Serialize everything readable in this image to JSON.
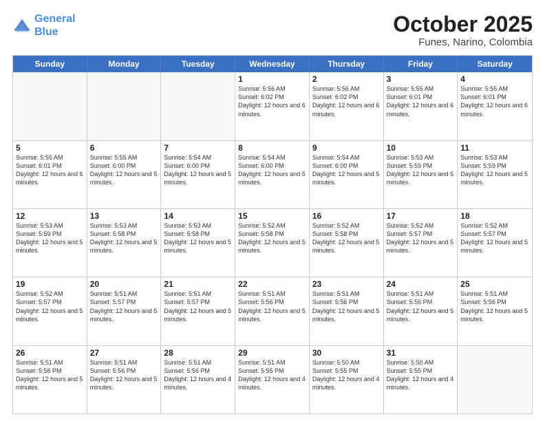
{
  "header": {
    "logo_line1": "General",
    "logo_line2": "Blue",
    "title": "October 2025",
    "subtitle": "Funes, Narino, Colombia"
  },
  "weekdays": [
    "Sunday",
    "Monday",
    "Tuesday",
    "Wednesday",
    "Thursday",
    "Friday",
    "Saturday"
  ],
  "rows": [
    [
      {
        "day": "",
        "info": "",
        "empty": true
      },
      {
        "day": "",
        "info": "",
        "empty": true
      },
      {
        "day": "",
        "info": "",
        "empty": true
      },
      {
        "day": "1",
        "info": "Sunrise: 5:56 AM\nSunset: 6:02 PM\nDaylight: 12 hours\nand 6 minutes.",
        "empty": false
      },
      {
        "day": "2",
        "info": "Sunrise: 5:56 AM\nSunset: 6:02 PM\nDaylight: 12 hours\nand 6 minutes.",
        "empty": false
      },
      {
        "day": "3",
        "info": "Sunrise: 5:55 AM\nSunset: 6:01 PM\nDaylight: 12 hours\nand 6 minutes.",
        "empty": false
      },
      {
        "day": "4",
        "info": "Sunrise: 5:55 AM\nSunset: 6:01 PM\nDaylight: 12 hours\nand 6 minutes.",
        "empty": false
      }
    ],
    [
      {
        "day": "5",
        "info": "Sunrise: 5:55 AM\nSunset: 6:01 PM\nDaylight: 12 hours\nand 6 minutes.",
        "empty": false
      },
      {
        "day": "6",
        "info": "Sunrise: 5:55 AM\nSunset: 6:00 PM\nDaylight: 12 hours\nand 5 minutes.",
        "empty": false
      },
      {
        "day": "7",
        "info": "Sunrise: 5:54 AM\nSunset: 6:00 PM\nDaylight: 12 hours\nand 5 minutes.",
        "empty": false
      },
      {
        "day": "8",
        "info": "Sunrise: 5:54 AM\nSunset: 6:00 PM\nDaylight: 12 hours\nand 5 minutes.",
        "empty": false
      },
      {
        "day": "9",
        "info": "Sunrise: 5:54 AM\nSunset: 6:00 PM\nDaylight: 12 hours\nand 5 minutes.",
        "empty": false
      },
      {
        "day": "10",
        "info": "Sunrise: 5:53 AM\nSunset: 5:59 PM\nDaylight: 12 hours\nand 5 minutes.",
        "empty": false
      },
      {
        "day": "11",
        "info": "Sunrise: 5:53 AM\nSunset: 5:59 PM\nDaylight: 12 hours\nand 5 minutes.",
        "empty": false
      }
    ],
    [
      {
        "day": "12",
        "info": "Sunrise: 5:53 AM\nSunset: 5:59 PM\nDaylight: 12 hours\nand 5 minutes.",
        "empty": false
      },
      {
        "day": "13",
        "info": "Sunrise: 5:53 AM\nSunset: 5:58 PM\nDaylight: 12 hours\nand 5 minutes.",
        "empty": false
      },
      {
        "day": "14",
        "info": "Sunrise: 5:53 AM\nSunset: 5:58 PM\nDaylight: 12 hours\nand 5 minutes.",
        "empty": false
      },
      {
        "day": "15",
        "info": "Sunrise: 5:52 AM\nSunset: 5:58 PM\nDaylight: 12 hours\nand 5 minutes.",
        "empty": false
      },
      {
        "day": "16",
        "info": "Sunrise: 5:52 AM\nSunset: 5:58 PM\nDaylight: 12 hours\nand 5 minutes.",
        "empty": false
      },
      {
        "day": "17",
        "info": "Sunrise: 5:52 AM\nSunset: 5:57 PM\nDaylight: 12 hours\nand 5 minutes.",
        "empty": false
      },
      {
        "day": "18",
        "info": "Sunrise: 5:52 AM\nSunset: 5:57 PM\nDaylight: 12 hours\nand 5 minutes.",
        "empty": false
      }
    ],
    [
      {
        "day": "19",
        "info": "Sunrise: 5:52 AM\nSunset: 5:57 PM\nDaylight: 12 hours\nand 5 minutes.",
        "empty": false
      },
      {
        "day": "20",
        "info": "Sunrise: 5:51 AM\nSunset: 5:57 PM\nDaylight: 12 hours\nand 5 minutes.",
        "empty": false
      },
      {
        "day": "21",
        "info": "Sunrise: 5:51 AM\nSunset: 5:57 PM\nDaylight: 12 hours\nand 5 minutes.",
        "empty": false
      },
      {
        "day": "22",
        "info": "Sunrise: 5:51 AM\nSunset: 5:56 PM\nDaylight: 12 hours\nand 5 minutes.",
        "empty": false
      },
      {
        "day": "23",
        "info": "Sunrise: 5:51 AM\nSunset: 5:56 PM\nDaylight: 12 hours\nand 5 minutes.",
        "empty": false
      },
      {
        "day": "24",
        "info": "Sunrise: 5:51 AM\nSunset: 5:56 PM\nDaylight: 12 hours\nand 5 minutes.",
        "empty": false
      },
      {
        "day": "25",
        "info": "Sunrise: 5:51 AM\nSunset: 5:56 PM\nDaylight: 12 hours\nand 5 minutes.",
        "empty": false
      }
    ],
    [
      {
        "day": "26",
        "info": "Sunrise: 5:51 AM\nSunset: 5:56 PM\nDaylight: 12 hours\nand 5 minutes.",
        "empty": false
      },
      {
        "day": "27",
        "info": "Sunrise: 5:51 AM\nSunset: 5:56 PM\nDaylight: 12 hours\nand 5 minutes.",
        "empty": false
      },
      {
        "day": "28",
        "info": "Sunrise: 5:51 AM\nSunset: 5:56 PM\nDaylight: 12 hours\nand 4 minutes.",
        "empty": false
      },
      {
        "day": "29",
        "info": "Sunrise: 5:51 AM\nSunset: 5:55 PM\nDaylight: 12 hours\nand 4 minutes.",
        "empty": false
      },
      {
        "day": "30",
        "info": "Sunrise: 5:50 AM\nSunset: 5:55 PM\nDaylight: 12 hours\nand 4 minutes.",
        "empty": false
      },
      {
        "day": "31",
        "info": "Sunrise: 5:50 AM\nSunset: 5:55 PM\nDaylight: 12 hours\nand 4 minutes.",
        "empty": false
      },
      {
        "day": "",
        "info": "",
        "empty": true
      }
    ]
  ]
}
